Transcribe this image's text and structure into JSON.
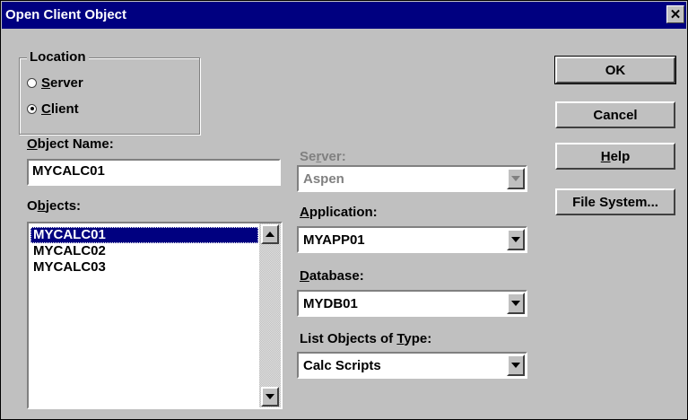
{
  "window": {
    "title": "Open Client Object",
    "close_glyph": "✕"
  },
  "location": {
    "legend": "Location",
    "options": [
      {
        "label": "Server",
        "checked": false
      },
      {
        "label": "Client",
        "checked": true
      }
    ]
  },
  "object_name": {
    "label": "Object Name:",
    "value": "MYCALC01"
  },
  "objects": {
    "label": "Objects:",
    "items": [
      "MYCALC01",
      "MYCALC02",
      "MYCALC03"
    ],
    "selected_index": 0
  },
  "server": {
    "label": "Server:",
    "value": "Aspen",
    "enabled": false
  },
  "application": {
    "label": "Application:",
    "value": "MYAPP01"
  },
  "database": {
    "label": "Database:",
    "value": "MYDB01"
  },
  "list_type": {
    "label": "List Objects of Type:",
    "value": "Calc Scripts"
  },
  "buttons": {
    "ok": "OK",
    "cancel": "Cancel",
    "help": "Help",
    "file_system": "File System..."
  },
  "colors": {
    "titlebar": "#000080",
    "face": "#c0c0c0",
    "selection": "#000080",
    "disabled_text": "#808080"
  }
}
